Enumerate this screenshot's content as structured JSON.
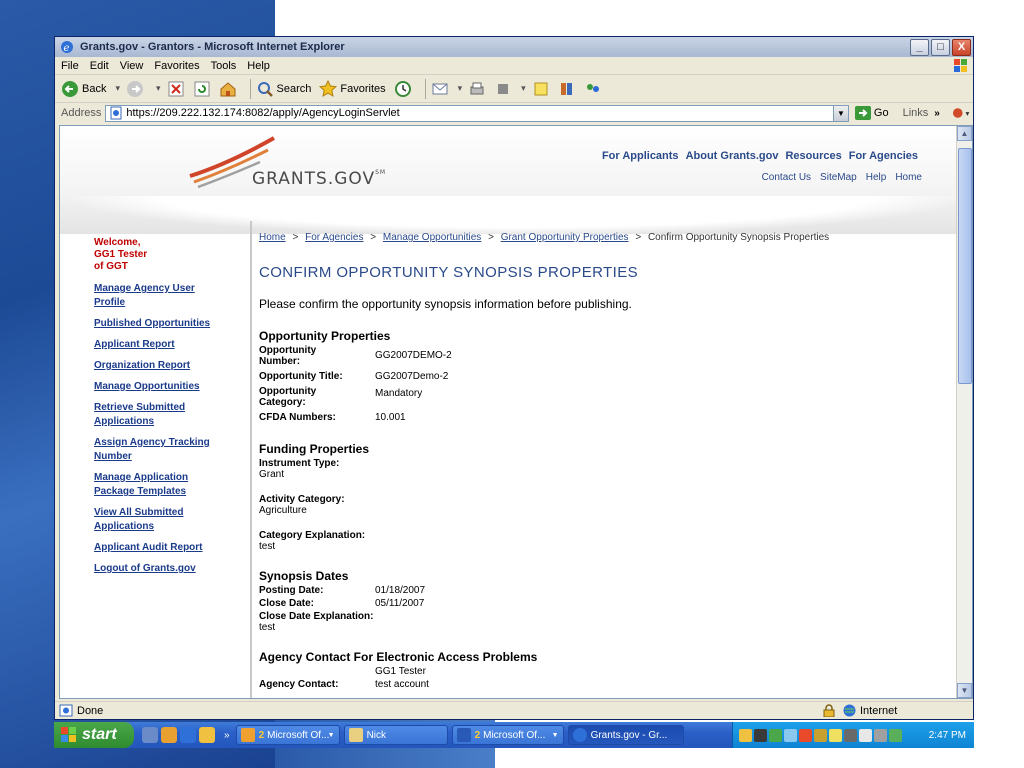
{
  "window": {
    "title": "Grants.gov - Grantors - Microsoft Internet Explorer",
    "minimize": "_",
    "maximize": "□",
    "close": "X"
  },
  "menu": [
    "File",
    "Edit",
    "View",
    "Favorites",
    "Tools",
    "Help"
  ],
  "toolbar": {
    "back": "Back",
    "search": "Search",
    "favorites": "Favorites"
  },
  "address": {
    "label": "Address",
    "url": "https://209.222.132.174:8082/apply/AgencyLoginServlet",
    "go": "Go",
    "links": "Links",
    "more": "»"
  },
  "site": {
    "logo": "GRANTS.GOV",
    "logo_mark": "SM",
    "topnav": [
      "For Applicants",
      "About Grants.gov",
      "Resources",
      "For Agencies"
    ],
    "subnav": [
      "Contact Us",
      "SiteMap",
      "Help",
      "Home"
    ]
  },
  "sidebar": {
    "welcome_line1": "Welcome,",
    "welcome_line2": "GG1 Tester",
    "welcome_line3": "of GGT",
    "items": [
      {
        "line1": "Manage Agency User",
        "line2": "Profile"
      },
      {
        "line1": "Published Opportunities",
        "line2": ""
      },
      {
        "line1": "Applicant Report",
        "line2": ""
      },
      {
        "line1": "Organization Report",
        "line2": ""
      },
      {
        "line1": "Manage Opportunities",
        "line2": ""
      },
      {
        "line1": "Retrieve Submitted",
        "line2": "Applications"
      },
      {
        "line1": "Assign Agency Tracking",
        "line2": "Number"
      },
      {
        "line1": "Manage Application",
        "line2": "Package Templates"
      },
      {
        "line1": "View All Submitted",
        "line2": "Applications"
      },
      {
        "line1": "Applicant Audit Report",
        "line2": ""
      },
      {
        "line1": "Logout of Grants.gov",
        "line2": ""
      }
    ]
  },
  "breadcrumb": {
    "items": [
      "Home",
      "For Agencies",
      "Manage Opportunities",
      "Grant Opportunity Properties"
    ],
    "current": "Confirm Opportunity Synopsis Properties",
    "sep": ">"
  },
  "main": {
    "title": "CONFIRM OPPORTUNITY SYNOPSIS PROPERTIES",
    "instruction": "Please confirm the opportunity synopsis information before publishing.",
    "opportunity": {
      "heading": "Opportunity Properties",
      "number_label_1": "Opportunity",
      "number_label_2": "Number:",
      "number": "GG2007DEMO-2",
      "title_label": "Opportunity Title:",
      "title": "GG2007Demo-2",
      "category_label_1": "Opportunity",
      "category_label_2": "Category:",
      "category": "Mandatory",
      "cfda_label": "CFDA Numbers:",
      "cfda": "10.001"
    },
    "funding": {
      "heading": "Funding Properties",
      "instrument_label": "Instrument Type:",
      "instrument": "Grant",
      "activity_label": "Activity Category:",
      "activity": "Agriculture",
      "explanation_label": "Category Explanation:",
      "explanation": "test"
    },
    "dates": {
      "heading": "Synopsis Dates",
      "posting_label": "Posting Date:",
      "posting": "01/18/2007",
      "close_label": "Close Date:",
      "close": "05/11/2007",
      "close_expl_label": "Close Date Explanation:",
      "close_expl": "test"
    },
    "contact": {
      "heading": "Agency Contact For Electronic Access Problems",
      "name": "GG1 Tester",
      "label": "Agency Contact:",
      "value": "test account"
    }
  },
  "status": {
    "text": "Done",
    "zone": "Internet"
  },
  "taskbar": {
    "start": "start",
    "more": "»",
    "tasks": [
      {
        "num": "2",
        "label": "Microsoft Of..."
      },
      {
        "num": "",
        "label": "Nick"
      },
      {
        "num": "2",
        "label": "Microsoft Of..."
      },
      {
        "num": "",
        "label": "Grants.gov - Gr..."
      }
    ],
    "clock": "2:47 PM"
  }
}
